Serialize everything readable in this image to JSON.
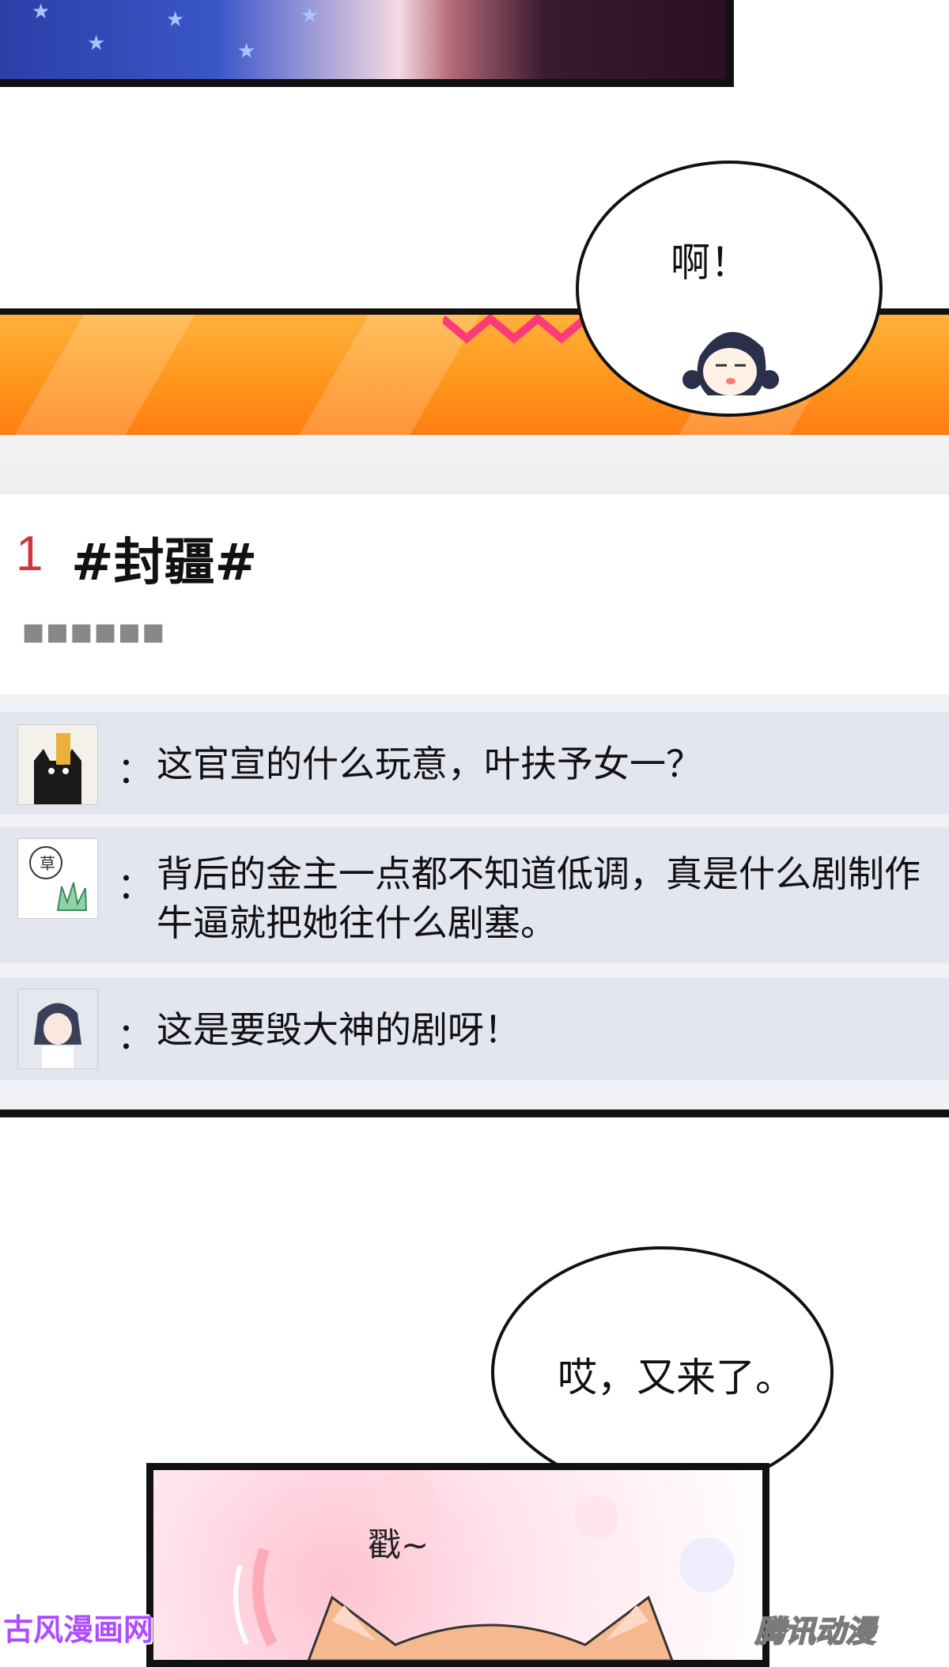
{
  "bubbles": {
    "top": "啊！",
    "middle": "哎，又来了。"
  },
  "topic": {
    "rank": "1",
    "title": "#封疆#",
    "dots": "■■■■■■"
  },
  "comments": [
    {
      "avatar": "cat-with-card-avatar",
      "colon": "：",
      "text": "这官宣的什么玩意，叶扶予女一？"
    },
    {
      "avatar": "grass-doodle-avatar",
      "colon": "：",
      "text": "背后的金主一点都不知道低调，真是什么剧制作牛逼就把她往什么剧塞。"
    },
    {
      "avatar": "anime-girl-avatar",
      "colon": "：",
      "text": "这是要毁大神的剧呀！"
    }
  ],
  "sfx": "戳~",
  "watermarks": {
    "left": "古风漫画网",
    "right": "腾讯动漫"
  },
  "colors": {
    "banner_orange": "#ff9a1f",
    "rank_red": "#d0363c",
    "comment_bg": "#e3e6ef",
    "watermark_purple": "#b04cff"
  }
}
